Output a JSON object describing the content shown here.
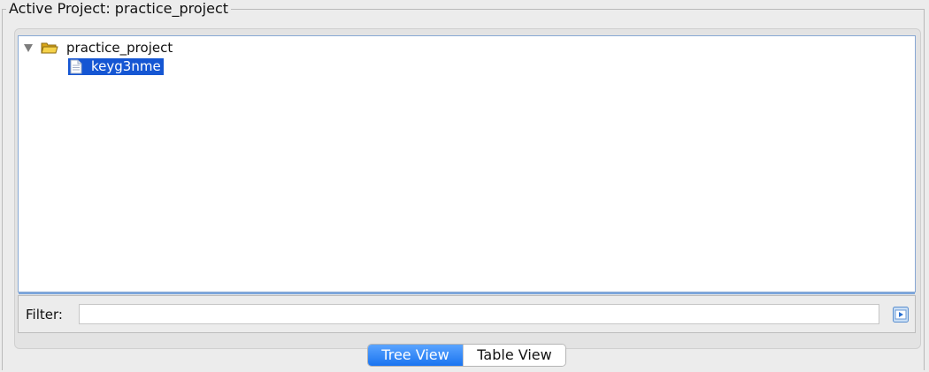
{
  "project": {
    "title": "Active Project: practice_project"
  },
  "tree": {
    "root": {
      "label": "practice_project",
      "icon": "folder-open-icon",
      "expanded": true
    },
    "children": [
      {
        "label": "keyg3nme",
        "icon": "document-icon",
        "selected": true
      }
    ]
  },
  "filter": {
    "label": "Filter:",
    "value": "",
    "button_icon": "filter-apply-icon"
  },
  "view_toggle": {
    "tree_label": "Tree View",
    "table_label": "Table View",
    "active": "Tree View"
  },
  "colors": {
    "selection": "#1556d3",
    "active_segment": "#2a80f5",
    "folder": "#e8b923"
  }
}
